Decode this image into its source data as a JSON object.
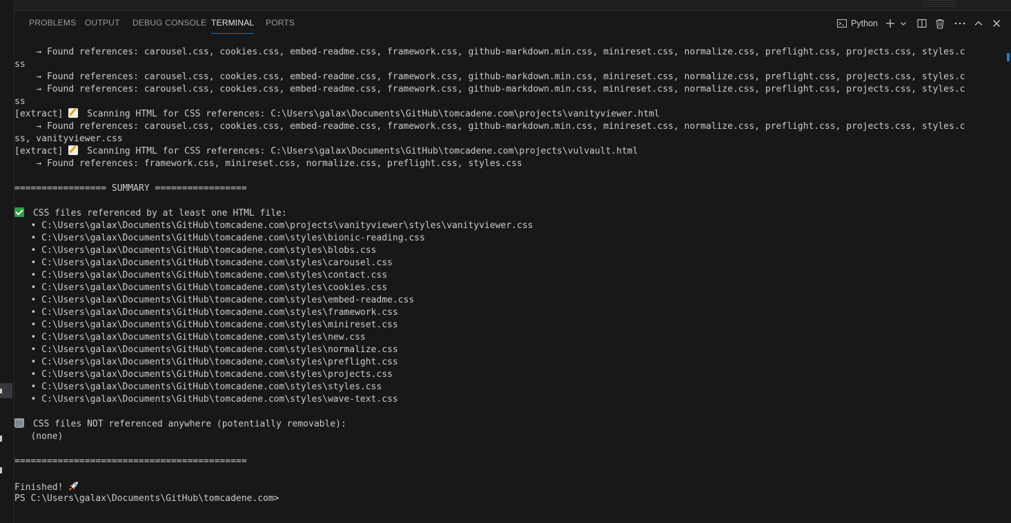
{
  "panel": {
    "tabs": [
      {
        "label": "PROBLEMS",
        "active": false
      },
      {
        "label": "OUTPUT",
        "active": false
      },
      {
        "label": "DEBUG CONSOLE",
        "active": false
      },
      {
        "label": "TERMINAL",
        "active": true
      },
      {
        "label": "PORTS",
        "active": false
      }
    ],
    "toolbar": {
      "profile_label": "Python",
      "icons": [
        "terminal-icon",
        "plus-icon",
        "chevron-down-icon",
        "split-icon",
        "trash-icon",
        "ellipsis-icon",
        "chevron-up-icon",
        "close-icon"
      ]
    }
  },
  "terminal": {
    "lines": [
      "    → Found references: carousel.css, cookies.css, embed-readme.css, framework.css, github-markdown.min.css, minireset.css, normalize.css, preflight.css, projects.css, styles.c",
      "ss",
      "    → Found references: carousel.css, cookies.css, embed-readme.css, framework.css, github-markdown.min.css, minireset.css, normalize.css, preflight.css, projects.css, styles.c",
      "    → Found references: carousel.css, cookies.css, embed-readme.css, framework.css, github-markdown.min.css, minireset.css, normalize.css, preflight.css, projects.css, styles.c",
      "ss",
      "[extract] {memo} Scanning HTML for CSS references: C:\\Users\\galax\\Documents\\GitHub\\tomcadene.com\\projects\\vanityviewer.html",
      "    → Found references: carousel.css, cookies.css, embed-readme.css, framework.css, github-markdown.min.css, minireset.css, normalize.css, preflight.css, projects.css, styles.c",
      "ss, vanityviewer.css",
      "[extract] {memo} Scanning HTML for CSS references: C:\\Users\\galax\\Documents\\GitHub\\tomcadene.com\\projects\\vulvault.html",
      "    → Found references: framework.css, minireset.css, normalize.css, preflight.css, styles.css",
      "",
      "================= SUMMARY =================",
      "",
      "{check} CSS files referenced by at least one HTML file:",
      "   • C:\\Users\\galax\\Documents\\GitHub\\tomcadene.com\\projects\\vanityviewer\\styles\\vanityviewer.css",
      "   • C:\\Users\\galax\\Documents\\GitHub\\tomcadene.com\\styles\\bionic-reading.css",
      "   • C:\\Users\\galax\\Documents\\GitHub\\tomcadene.com\\styles\\blobs.css",
      "   • C:\\Users\\galax\\Documents\\GitHub\\tomcadene.com\\styles\\carousel.css",
      "   • C:\\Users\\galax\\Documents\\GitHub\\tomcadene.com\\styles\\contact.css",
      "   • C:\\Users\\galax\\Documents\\GitHub\\tomcadene.com\\styles\\cookies.css",
      "   • C:\\Users\\galax\\Documents\\GitHub\\tomcadene.com\\styles\\embed-readme.css",
      "   • C:\\Users\\galax\\Documents\\GitHub\\tomcadene.com\\styles\\framework.css",
      "   • C:\\Users\\galax\\Documents\\GitHub\\tomcadene.com\\styles\\minireset.css",
      "   • C:\\Users\\galax\\Documents\\GitHub\\tomcadene.com\\styles\\new.css",
      "   • C:\\Users\\galax\\Documents\\GitHub\\tomcadene.com\\styles\\normalize.css",
      "   • C:\\Users\\galax\\Documents\\GitHub\\tomcadene.com\\styles\\preflight.css",
      "   • C:\\Users\\galax\\Documents\\GitHub\\tomcadene.com\\styles\\projects.css",
      "   • C:\\Users\\galax\\Documents\\GitHub\\tomcadene.com\\styles\\styles.css",
      "   • C:\\Users\\galax\\Documents\\GitHub\\tomcadene.com\\styles\\wave-text.css",
      "",
      "{trash} CSS files NOT referenced anywhere (potentially removable):",
      "   (none)",
      "",
      "===========================================",
      "",
      "Finished! {rocket}",
      "PS C:\\Users\\galax\\Documents\\GitHub\\tomcadene.com>"
    ]
  },
  "colors": {
    "background": "#181818",
    "text": "#cccccc",
    "tab_inactive": "#9d9d9d",
    "tab_active": "#e7e7e7",
    "accent": "#0078d4"
  }
}
